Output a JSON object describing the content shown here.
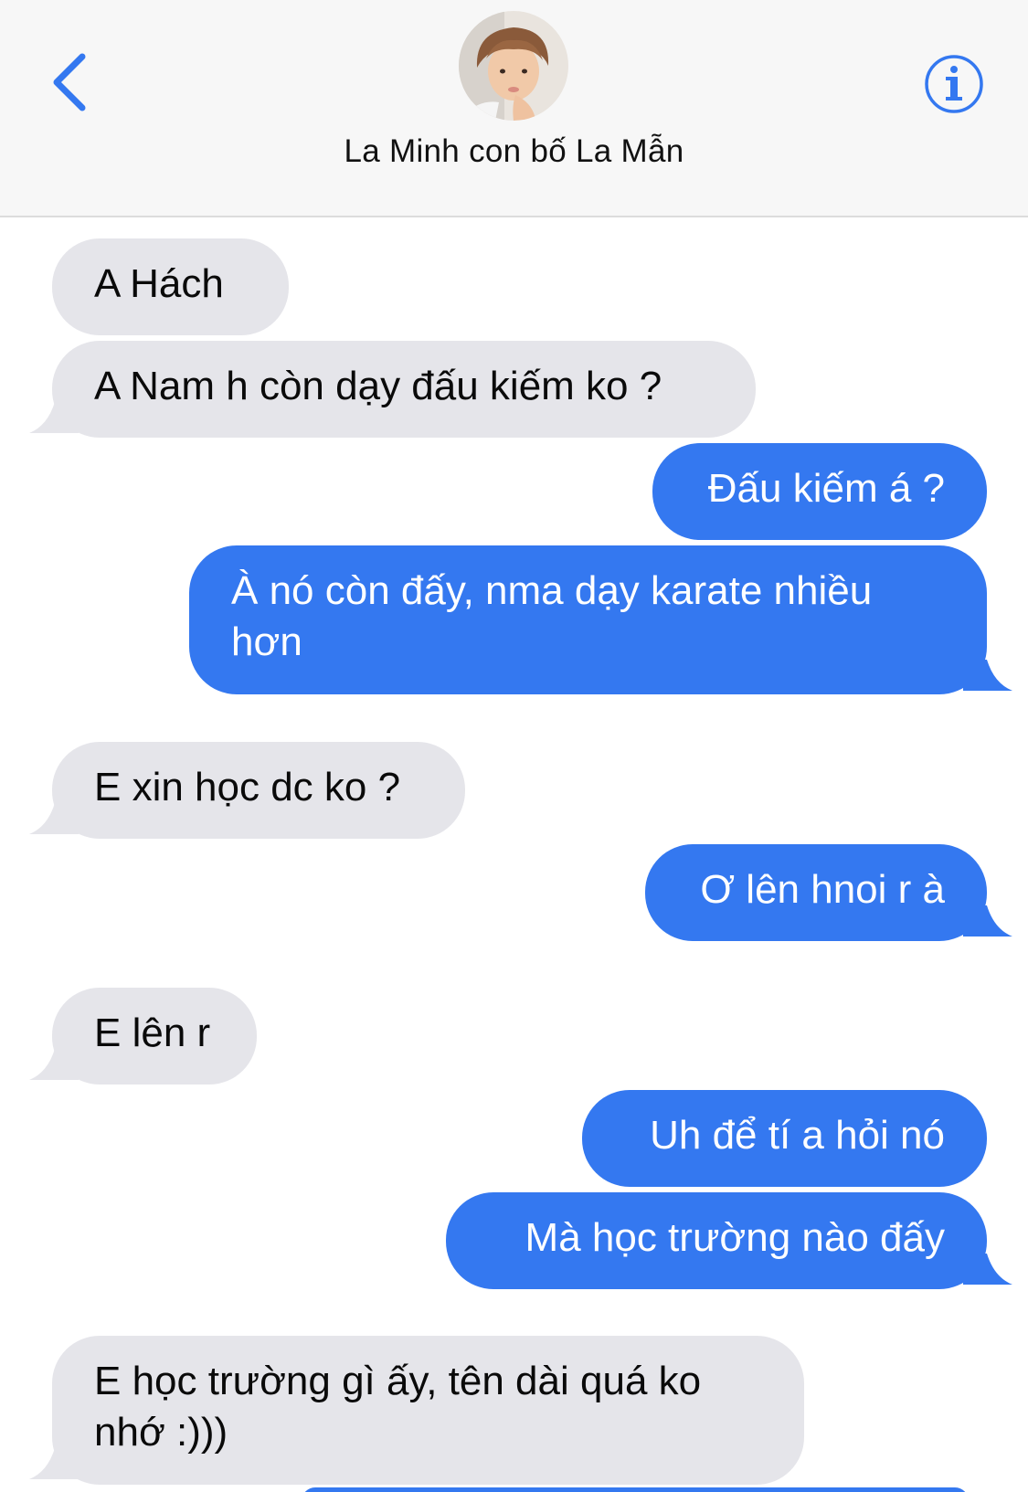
{
  "header": {
    "contact_name": "La Minh con bố La Mẫn",
    "back_icon": "chevron-left-icon",
    "info_icon": "info-circle-icon",
    "accent_color": "#3478f0"
  },
  "messages": [
    {
      "direction": "incoming",
      "text": "A Hách"
    },
    {
      "direction": "incoming",
      "text": "A Nam h còn dạy đấu kiếm ko ?"
    },
    {
      "direction": "outgoing",
      "text": "Đấu kiếm á ?"
    },
    {
      "direction": "outgoing",
      "text": "À nó còn đấy, nma dạy karate nhiều hơn"
    },
    {
      "direction": "incoming",
      "text": "E xin học dc ko ?"
    },
    {
      "direction": "outgoing",
      "text": "Ơ lên hnoi r à"
    },
    {
      "direction": "incoming",
      "text": "E lên r"
    },
    {
      "direction": "outgoing",
      "text": "Uh để tí a hỏi nó"
    },
    {
      "direction": "outgoing",
      "text": "Mà học trường nào đấy"
    },
    {
      "direction": "incoming",
      "text": "E học trường gì ấy, tên dài quá ko nhớ :)))"
    }
  ],
  "colors": {
    "incoming_bubble": "#e5e5ea",
    "outgoing_bubble": "#3478f0",
    "header_bg": "#f7f7f7"
  }
}
